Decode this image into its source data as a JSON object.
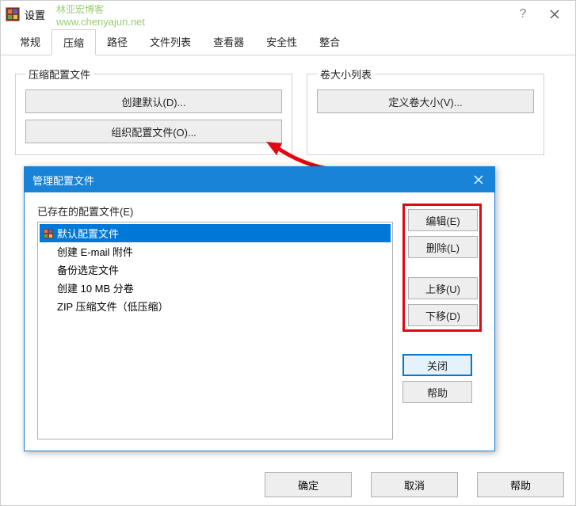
{
  "window": {
    "title": "设置",
    "watermark_line1": "林亚宏博客",
    "watermark_line2": "www.chenyajun.net"
  },
  "tabs": [
    "常规",
    "压缩",
    "路径",
    "文件列表",
    "查看器",
    "安全性",
    "整合"
  ],
  "active_tab_index": 1,
  "groups": {
    "compress_profiles": {
      "legend": "压缩配置文件",
      "create_default": "创建默认(D)...",
      "organize_profiles": "组织配置文件(O)..."
    },
    "volume": {
      "legend": "卷大小列表",
      "define_volume": "定义卷大小(V)..."
    }
  },
  "dialog": {
    "title": "管理配置文件",
    "list_label": "已存在的配置文件(E)",
    "items": [
      "默认配置文件",
      "创建 E-mail 附件",
      "备份选定文件",
      "创建 10 MB 分卷",
      "ZIP 压缩文件（低压缩）"
    ],
    "selected_index": 0,
    "buttons": {
      "edit": "编辑(E)",
      "delete": "删除(L)",
      "up": "上移(U)",
      "down": "下移(D)",
      "close": "关闭",
      "help": "帮助"
    }
  },
  "footer": {
    "ok": "确定",
    "cancel": "取消",
    "help": "帮助"
  }
}
